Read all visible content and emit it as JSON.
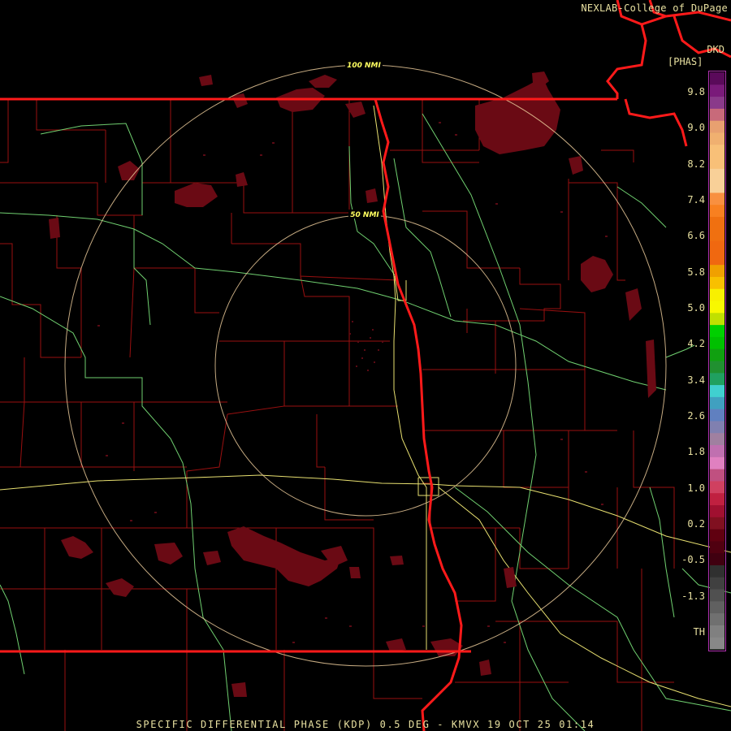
{
  "header": {
    "credit": "NEXLAB-College of DuPage"
  },
  "legend": {
    "unit_line1": "DKD",
    "unit_line2": "[PHAS]",
    "ticks": [
      "9.8",
      "9.0",
      "8.2",
      "7.4",
      "6.6",
      "5.8",
      "5.0",
      "4.2",
      "3.4",
      "2.6",
      "1.8",
      "1.0",
      "0.2",
      "-0.5",
      "-1.3",
      "TH"
    ],
    "colors": [
      "#5a0a5a",
      "#7a1a7a",
      "#8a3a8a",
      "#c86a7a",
      "#e8a070",
      "#f0b070",
      "#f8c078",
      "#f8c078",
      "#f8d098",
      "#f8d098",
      "#f89040",
      "#f88020",
      "#f07010",
      "#f07010",
      "#f06810",
      "#f06810",
      "#f0a000",
      "#f8c000",
      "#f8f000",
      "#f8f800",
      "#c0e000",
      "#00d000",
      "#00c000",
      "#10a010",
      "#209030",
      "#20a060",
      "#40d0d0",
      "#40a0c0",
      "#6080c0",
      "#8080b0",
      "#a080a0",
      "#c070b0",
      "#e080c0",
      "#c05080",
      "#d04060",
      "#c02040",
      "#a01030",
      "#801020",
      "#600010",
      "#500010",
      "#400010",
      "#303030",
      "#404040",
      "#505050",
      "#606060",
      "#707070",
      "#808080",
      "#888888"
    ]
  },
  "rings": {
    "outer_label": "100 NMI",
    "inner_label": "50 NMI",
    "ring_color": "#e8c898"
  },
  "footer": {
    "title": "SPECIFIC DIFFERENTIAL PHASE (KDP) 0.5 DEG - KMVX 19 OCT 25 01:14"
  },
  "colors": {
    "state_border": "#ff1a1a",
    "county_line": "#a01010",
    "highway_green": "#70d070",
    "highway_yellow": "#e8e070",
    "echo_fill": "#6a0a14",
    "text": "#e8e0a0"
  }
}
